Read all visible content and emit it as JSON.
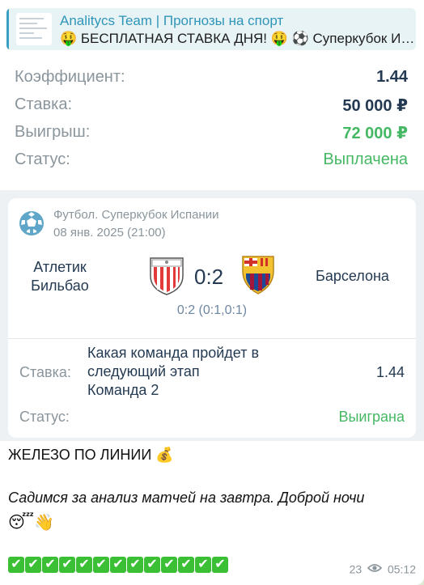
{
  "reply": {
    "title": "Analitycs Team | Прогнозы на спорт",
    "text": "🤑 БЕСПЛАТНАЯ СТАВКА ДНЯ! 🤑 ⚽ Суперкубок Ис..."
  },
  "summary": {
    "rows": [
      {
        "label": "Коэффициент:",
        "value": "1.44"
      },
      {
        "label": "Ставка:",
        "value": "50 000 ₽"
      },
      {
        "label": "Выигрыш:",
        "value": "72 000 ₽"
      },
      {
        "label": "Статус:",
        "value": "Выплачена"
      }
    ]
  },
  "match": {
    "sport_line": "Футбол. Суперкубок Испании",
    "date_line": "08 янв. 2025 (21:00)",
    "team1": "Атлетик Бильбао",
    "team2": "Барселона",
    "score": "0:2",
    "subscore": "0:2 (0:1,0:1)",
    "bet_label": "Ставка:",
    "bet_lines": [
      "Какая команда пройдет в",
      "следующий этап",
      "Команда 2"
    ],
    "bet_odds": "1.44",
    "status_label": "Статус:",
    "status_value": "Выиграна"
  },
  "caption": {
    "line1": "ЖЕЛЕЗО ПО ЛИНИИ 💰",
    "line2": "Садимся за анализ матчей на завтра. Доброй ночи",
    "line3": "😴👋",
    "checkmarks": [
      "✔",
      "✔",
      "✔",
      "✔",
      "✔",
      "✔",
      "✔",
      "✔",
      "✔",
      "✔",
      "✔",
      "✔",
      "✔"
    ]
  },
  "footer": {
    "views": "23",
    "time": "05:12"
  },
  "colors": {
    "accent": "#2f95b8",
    "green": "#45b864",
    "text_dark": "#243a52",
    "muted": "#8a959c"
  }
}
